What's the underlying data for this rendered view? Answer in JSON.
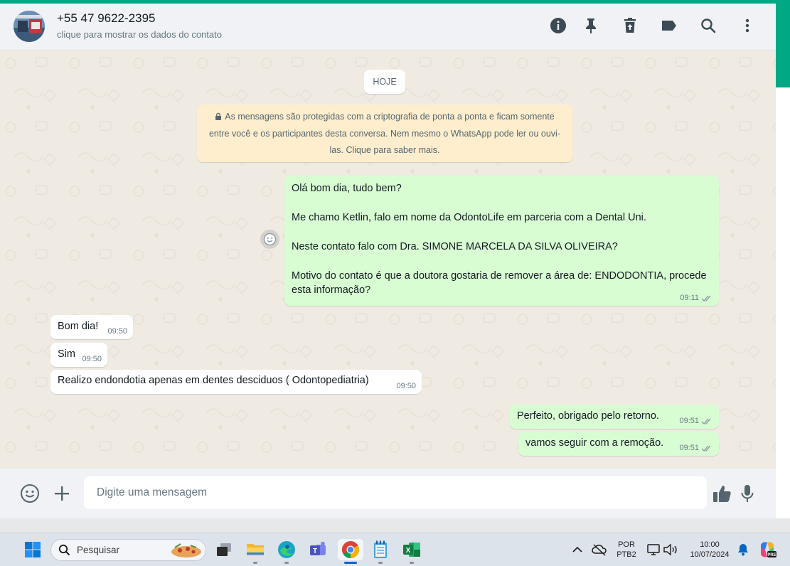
{
  "header": {
    "contact_name": "+55 47 9622-2395",
    "contact_sub": "clique para mostrar os dados do contato",
    "icons": [
      "info-icon",
      "pin-icon",
      "delete-icon",
      "label-icon",
      "search-icon",
      "menu-icon"
    ]
  },
  "chat": {
    "date_chip": "HOJE",
    "encryption_notice": "As mensagens são protegidas com a criptografia de ponta a ponta e ficam somente entre você e os participantes desta conversa. Nem mesmo o WhatsApp pode ler ou ouvi-las. Clique para saber mais.",
    "messages": [
      {
        "direction": "out",
        "lines": [
          "Olá bom dia, tudo bem?",
          "Me chamo Ketlin, falo em nome da OdontoLife em parceria com a Dental Uni.",
          "Neste contato falo com Dra. SIMONE MARCELA DA SILVA OLIVEIRA?",
          "Motivo do contato é que a doutora gostaria de remover a área de: ENDODONTIA, procede esta informação?"
        ],
        "time": "09:11",
        "status": "read"
      },
      {
        "direction": "in",
        "text": "Bom dia!",
        "time": "09:50"
      },
      {
        "direction": "in",
        "text": "Sim",
        "time": "09:50"
      },
      {
        "direction": "in",
        "text": "Realizo endondotia apenas em dentes desciduos ( Odontopediatria)",
        "time": "09:50"
      },
      {
        "direction": "out",
        "text": "Perfeito, obrigado pelo retorno.",
        "time": "09:51",
        "status": "read"
      },
      {
        "direction": "out",
        "text": "vamos seguir com a remoção.",
        "time": "09:51",
        "status": "read"
      }
    ]
  },
  "composer": {
    "placeholder": "Digite uma mensagem",
    "icons": [
      "emoji-icon",
      "attach-plus-icon",
      "sticker-like-icon",
      "microphone-icon"
    ]
  },
  "taskbar": {
    "search_placeholder": "Pesquisar",
    "apps": [
      "windows-start-icon",
      "task-view-icon",
      "file-explorer-icon",
      "edge-icon",
      "teams-icon",
      "chrome-icon",
      "notepad-icon",
      "excel-icon"
    ],
    "lang_line1": "POR",
    "lang_line2": "PTB2",
    "clock_time": "10:00",
    "clock_date": "10/07/2024"
  },
  "colors": {
    "accent": "#00a884",
    "outgoing_bubble": "#d9fdd3",
    "incoming_bubble": "#ffffff",
    "encryption_bg": "#ffeecd",
    "read_ticks": "#8696a0"
  }
}
